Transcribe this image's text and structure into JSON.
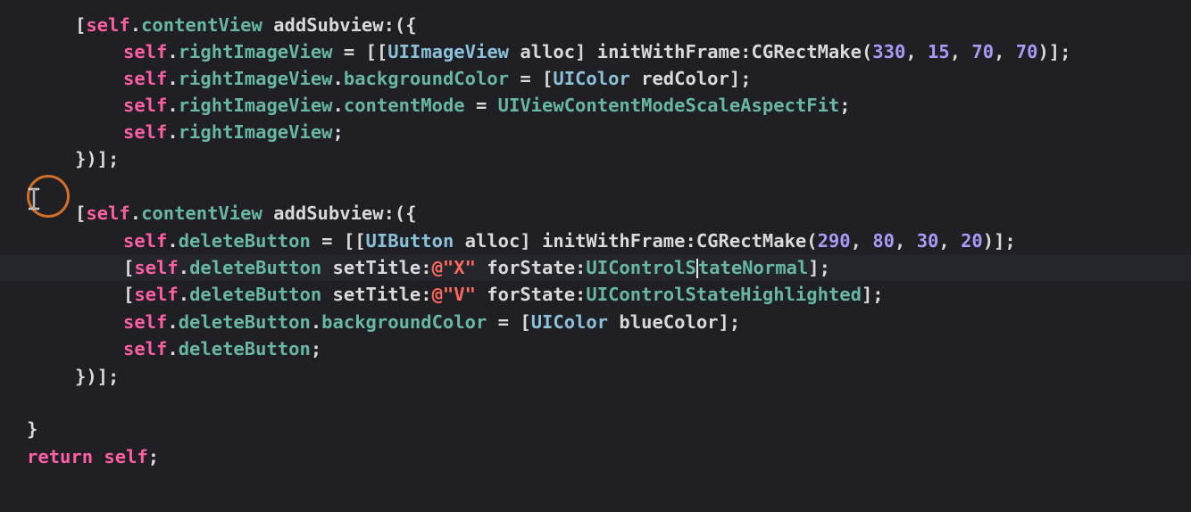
{
  "editor": {
    "current_line_index": 9,
    "lines": [
      {
        "segments": [
          {
            "t": "[",
            "c": "plain"
          },
          {
            "t": "self",
            "c": "kw"
          },
          {
            "t": ".",
            "c": "plain"
          },
          {
            "t": "contentView",
            "c": "prop"
          },
          {
            "t": " addSubview:({",
            "c": "plain"
          }
        ]
      },
      {
        "segments": [
          {
            "t": "self",
            "c": "kw"
          },
          {
            "t": ".",
            "c": "plain"
          },
          {
            "t": "rightImageView",
            "c": "prop"
          },
          {
            "t": " = [[",
            "c": "plain"
          },
          {
            "t": "UIImageView",
            "c": "cls"
          },
          {
            "t": " alloc] initWithFrame:",
            "c": "plain"
          },
          {
            "t": "CGRectMake",
            "c": "fn"
          },
          {
            "t": "(",
            "c": "plain"
          },
          {
            "t": "330",
            "c": "num"
          },
          {
            "t": ", ",
            "c": "plain"
          },
          {
            "t": "15",
            "c": "num"
          },
          {
            "t": ", ",
            "c": "plain"
          },
          {
            "t": "70",
            "c": "num"
          },
          {
            "t": ", ",
            "c": "plain"
          },
          {
            "t": "70",
            "c": "num"
          },
          {
            "t": ")];",
            "c": "plain"
          }
        ]
      },
      {
        "segments": [
          {
            "t": "self",
            "c": "kw"
          },
          {
            "t": ".",
            "c": "plain"
          },
          {
            "t": "rightImageView",
            "c": "prop"
          },
          {
            "t": ".",
            "c": "plain"
          },
          {
            "t": "backgroundColor",
            "c": "prop"
          },
          {
            "t": " = [",
            "c": "plain"
          },
          {
            "t": "UIColor",
            "c": "cls"
          },
          {
            "t": " redColor];",
            "c": "plain"
          }
        ]
      },
      {
        "segments": [
          {
            "t": "self",
            "c": "kw"
          },
          {
            "t": ".",
            "c": "plain"
          },
          {
            "t": "rightImageView",
            "c": "prop"
          },
          {
            "t": ".",
            "c": "plain"
          },
          {
            "t": "contentMode",
            "c": "prop"
          },
          {
            "t": " = ",
            "c": "plain"
          },
          {
            "t": "UIViewContentModeScaleAspectFit",
            "c": "prop"
          },
          {
            "t": ";",
            "c": "plain"
          }
        ]
      },
      {
        "segments": [
          {
            "t": "self",
            "c": "kw"
          },
          {
            "t": ".",
            "c": "plain"
          },
          {
            "t": "rightImageView",
            "c": "prop"
          },
          {
            "t": ";",
            "c": "plain"
          }
        ]
      },
      {
        "segments": [
          {
            "t": "})];",
            "c": "plain"
          }
        ]
      },
      {
        "segments": []
      },
      {
        "segments": [
          {
            "t": "[",
            "c": "plain"
          },
          {
            "t": "self",
            "c": "kw"
          },
          {
            "t": ".",
            "c": "plain"
          },
          {
            "t": "contentView",
            "c": "prop"
          },
          {
            "t": " addSubview:({",
            "c": "plain"
          }
        ]
      },
      {
        "segments": [
          {
            "t": "self",
            "c": "kw"
          },
          {
            "t": ".",
            "c": "plain"
          },
          {
            "t": "deleteButton",
            "c": "prop"
          },
          {
            "t": " = [[",
            "c": "plain"
          },
          {
            "t": "UIButton",
            "c": "cls"
          },
          {
            "t": " alloc] initWithFrame:",
            "c": "plain"
          },
          {
            "t": "CGRectMake",
            "c": "fn"
          },
          {
            "t": "(",
            "c": "plain"
          },
          {
            "t": "290",
            "c": "num"
          },
          {
            "t": ", ",
            "c": "plain"
          },
          {
            "t": "80",
            "c": "num"
          },
          {
            "t": ", ",
            "c": "plain"
          },
          {
            "t": "30",
            "c": "num"
          },
          {
            "t": ", ",
            "c": "plain"
          },
          {
            "t": "20",
            "c": "num"
          },
          {
            "t": ")];",
            "c": "plain"
          }
        ]
      },
      {
        "segments": [
          {
            "t": "[",
            "c": "plain"
          },
          {
            "t": "self",
            "c": "kw"
          },
          {
            "t": ".",
            "c": "plain"
          },
          {
            "t": "deleteButton",
            "c": "prop"
          },
          {
            "t": " setTitle:",
            "c": "plain"
          },
          {
            "t": "@\"X\"",
            "c": "str"
          },
          {
            "t": " forState:",
            "c": "plain"
          },
          {
            "t": "UIControlS",
            "c": "prop"
          },
          {
            "t": "",
            "c": "caret"
          },
          {
            "t": "tateNormal",
            "c": "prop"
          },
          {
            "t": "];",
            "c": "plain"
          }
        ]
      },
      {
        "segments": [
          {
            "t": "[",
            "c": "plain"
          },
          {
            "t": "self",
            "c": "kw"
          },
          {
            "t": ".",
            "c": "plain"
          },
          {
            "t": "deleteButton",
            "c": "prop"
          },
          {
            "t": " setTitle:",
            "c": "plain"
          },
          {
            "t": "@\"V\"",
            "c": "str"
          },
          {
            "t": " forState:",
            "c": "plain"
          },
          {
            "t": "UIControlStateHighlighted",
            "c": "prop"
          },
          {
            "t": "];",
            "c": "plain"
          }
        ]
      },
      {
        "segments": [
          {
            "t": "self",
            "c": "kw"
          },
          {
            "t": ".",
            "c": "plain"
          },
          {
            "t": "deleteButton",
            "c": "prop"
          },
          {
            "t": ".",
            "c": "plain"
          },
          {
            "t": "backgroundColor",
            "c": "prop"
          },
          {
            "t": " = [",
            "c": "plain"
          },
          {
            "t": "UIColor",
            "c": "cls"
          },
          {
            "t": " blueColor];",
            "c": "plain"
          }
        ]
      },
      {
        "segments": [
          {
            "t": "self",
            "c": "kw"
          },
          {
            "t": ".",
            "c": "plain"
          },
          {
            "t": "deleteButton",
            "c": "prop"
          },
          {
            "t": ";",
            "c": "plain"
          }
        ]
      },
      {
        "segments": [
          {
            "t": "})];",
            "c": "plain"
          }
        ]
      },
      {
        "segments": []
      },
      {
        "segments": [
          {
            "t": "}",
            "c": "plain"
          }
        ]
      },
      {
        "segments": [
          {
            "t": "return",
            "c": "kw"
          },
          {
            "t": " ",
            "c": "plain"
          },
          {
            "t": "self",
            "c": "kw"
          },
          {
            "t": ";",
            "c": "plain"
          }
        ]
      }
    ]
  },
  "colors": {
    "background": "#1f1f24",
    "current_line": "#25262b",
    "keyword": "#fc5fa3",
    "class": "#8ac1d9",
    "property": "#67b7a4",
    "number": "#a89af5",
    "string": "#fc6a5d",
    "plain": "#d9d9dc",
    "cursor_highlight": "#d06f27"
  },
  "icons": {
    "mouse_cursor": "ibeam-cursor-icon",
    "cursor_highlight": "click-highlight-ring-icon"
  }
}
